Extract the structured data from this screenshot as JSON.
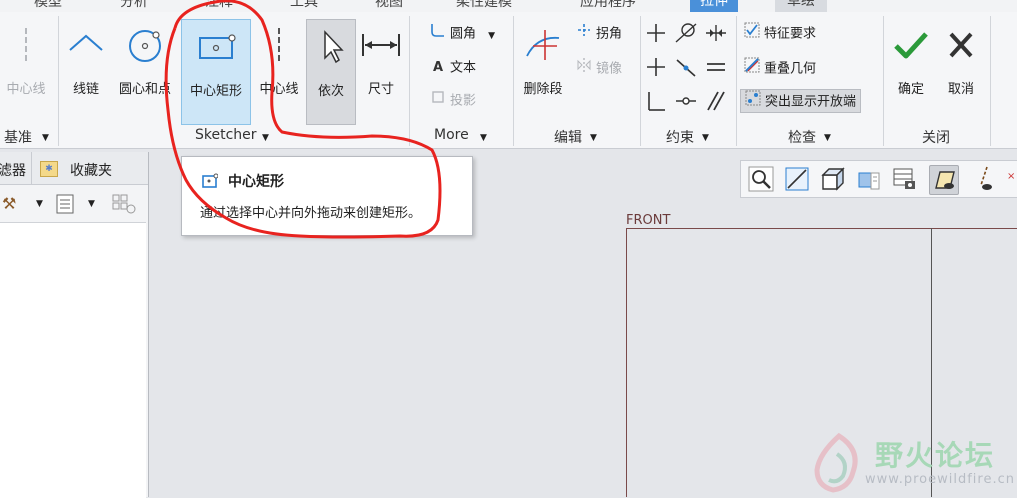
{
  "tabs": [
    "模型",
    "分析",
    "注释",
    "工具",
    "视图",
    "柔性建模",
    "应用程序",
    "拉伸",
    "草绘"
  ],
  "ribbon": {
    "groups": {
      "datum": "基准",
      "sketcher": "Sketcher",
      "more": "More",
      "edit": "编辑",
      "constrain": "约束",
      "inspect": "检查",
      "close": "关闭"
    },
    "datum_centerline": "中心线",
    "polyline": "线链",
    "center_point_circle": "圆心和点",
    "center_rectangle": "中心矩形",
    "centerline": "中心线",
    "select": "依次",
    "dimension": "尺寸",
    "fillet": "圆角",
    "text": "文本",
    "project": "投影",
    "delete_segment": "删除段",
    "corner": "拐角",
    "mirror": "镜像",
    "feature_requirements": "特征要求",
    "overlapping_geometry": "重叠几何",
    "highlight_open_ends": "突出显示开放端",
    "ok": "确定",
    "cancel": "取消"
  },
  "leftpanel": {
    "tab_filter": "滤器",
    "tab_favorites": "收藏夹"
  },
  "tooltip": {
    "title": "中心矩形",
    "description": "通过选择中心并向外拖动来创建矩形。"
  },
  "canvas": {
    "plane_label": "FRONT"
  },
  "watermark": {
    "name": "野火论坛",
    "url": "www.proewildfire.cn"
  },
  "colors": {
    "annotation": "#e8231f",
    "selected_bg": "#cde6f7",
    "ok_green": "#2b9a3a",
    "active_tab": "#4a90d9"
  }
}
